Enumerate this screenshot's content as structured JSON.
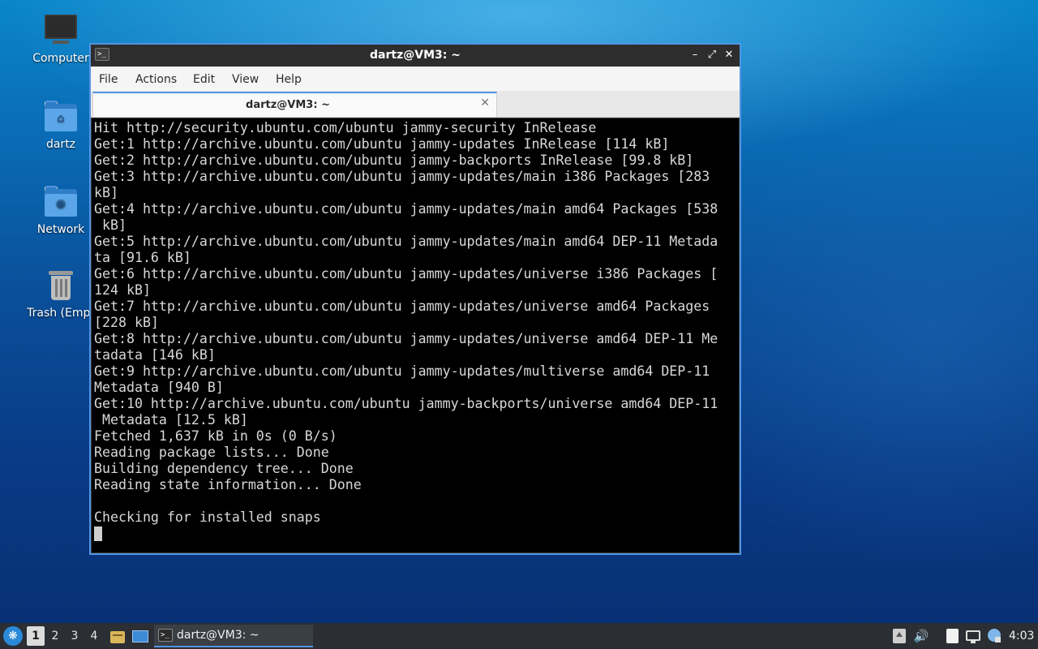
{
  "desktop": {
    "icons": [
      {
        "label": "Computer",
        "icon": "computer-icon"
      },
      {
        "label": "dartz",
        "icon": "home-folder-icon"
      },
      {
        "label": "Network",
        "icon": "network-folder-icon"
      },
      {
        "label": "Trash (Empt",
        "icon": "trash-icon"
      }
    ]
  },
  "window": {
    "title": "dartz@VM3: ~",
    "app_icon_glyph": ">_",
    "controls": {
      "minimize": "–",
      "maximize": "⤢",
      "close": "✕"
    },
    "menu": [
      "File",
      "Actions",
      "Edit",
      "View",
      "Help"
    ],
    "tab": {
      "label": "dartz@VM3: ~",
      "close": "✕"
    }
  },
  "terminal": {
    "lines": [
      "Hit http://security.ubuntu.com/ubuntu jammy-security InRelease",
      "Get:1 http://archive.ubuntu.com/ubuntu jammy-updates InRelease [114 kB]",
      "Get:2 http://archive.ubuntu.com/ubuntu jammy-backports InRelease [99.8 kB]",
      "Get:3 http://archive.ubuntu.com/ubuntu jammy-updates/main i386 Packages [283",
      "kB]",
      "Get:4 http://archive.ubuntu.com/ubuntu jammy-updates/main amd64 Packages [538",
      " kB]",
      "Get:5 http://archive.ubuntu.com/ubuntu jammy-updates/main amd64 DEP-11 Metada",
      "ta [91.6 kB]",
      "Get:6 http://archive.ubuntu.com/ubuntu jammy-updates/universe i386 Packages [",
      "124 kB]",
      "Get:7 http://archive.ubuntu.com/ubuntu jammy-updates/universe amd64 Packages",
      "[228 kB]",
      "Get:8 http://archive.ubuntu.com/ubuntu jammy-updates/universe amd64 DEP-11 Me",
      "tadata [146 kB]",
      "Get:9 http://archive.ubuntu.com/ubuntu jammy-updates/multiverse amd64 DEP-11",
      "Metadata [940 B]",
      "Get:10 http://archive.ubuntu.com/ubuntu jammy-backports/universe amd64 DEP-11",
      " Metadata [12.5 kB]",
      "Fetched 1,637 kB in 0s (0 B/s)",
      "Reading package lists... Done",
      "Building dependency tree... Done",
      "Reading state information... Done",
      "",
      "Checking for installed snaps"
    ]
  },
  "taskbar": {
    "start_glyph": "❋",
    "workspaces": [
      "1",
      "2",
      "3",
      "4"
    ],
    "active_workspace": "1",
    "task": {
      "label": "dartz@VM3: ~",
      "icon_glyph": ">_"
    },
    "volume_glyph": "🔊",
    "clock": "4:03"
  },
  "colors": {
    "accent": "#5294e2",
    "terminal_bg": "#000000",
    "terminal_fg": "#d8d8d8",
    "taskbar_bg": "#2b2e33"
  }
}
